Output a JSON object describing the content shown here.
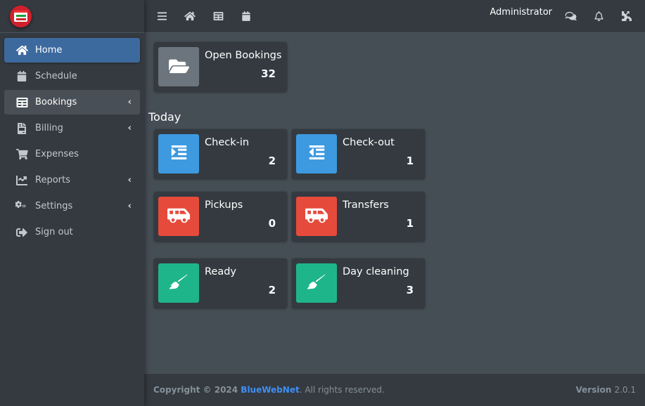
{
  "app": {
    "logo_icon": "calendar-logo-icon"
  },
  "sidebar": {
    "items": [
      {
        "label": "Home",
        "icon": "home-icon",
        "active": true,
        "has_submenu": false
      },
      {
        "label": "Schedule",
        "icon": "calendar-icon",
        "active": false,
        "has_submenu": false
      },
      {
        "label": "Bookings",
        "icon": "table-list-icon",
        "active": false,
        "has_submenu": true,
        "highlighted": true
      },
      {
        "label": "Billing",
        "icon": "invoice-icon",
        "active": false,
        "has_submenu": true
      },
      {
        "label": "Expenses",
        "icon": "cart-plus-icon",
        "active": false,
        "has_submenu": false
      },
      {
        "label": "Reports",
        "icon": "chart-line-icon",
        "active": false,
        "has_submenu": true
      },
      {
        "label": "Settings",
        "icon": "cogs-icon",
        "active": false,
        "has_submenu": true
      },
      {
        "label": "Sign out",
        "icon": "sign-out-icon",
        "active": false,
        "has_submenu": false
      }
    ],
    "chevron": "‹"
  },
  "topbar": {
    "left_icons": [
      "menu-icon",
      "home-icon",
      "table-list-icon",
      "calendar-icon"
    ],
    "user": "Administrator",
    "right_icons": [
      "chat-icon",
      "bell-icon",
      "expand-icon"
    ]
  },
  "dashboard": {
    "open_bookings": {
      "title": "Open Bookings",
      "value": "32",
      "icon": "folder-open-icon",
      "color": "#6c757d"
    },
    "section_title": "Today",
    "cards": [
      {
        "title": "Check-in",
        "value": "2",
        "icon": "indent-icon",
        "color": "#3d9ae0"
      },
      {
        "title": "Check-out",
        "value": "1",
        "icon": "outdent-icon",
        "color": "#3d9ae0"
      },
      {
        "title": "Pickups",
        "value": "0",
        "icon": "shuttle-van-icon",
        "color": "#e64a3b"
      },
      {
        "title": "Transfers",
        "value": "1",
        "icon": "shuttle-van-icon",
        "color": "#e64a3b"
      },
      {
        "title": "Ready",
        "value": "2",
        "icon": "broom-icon",
        "color": "#1fb58a"
      },
      {
        "title": "Day cleaning",
        "value": "3",
        "icon": "broom-icon",
        "color": "#1fb58a"
      }
    ]
  },
  "footer": {
    "copyright_prefix": "Copyright © 2024",
    "brand": "BlueWebNet",
    "rights": ". All rights reserved.",
    "version_label": "Version",
    "version": "2.0.1"
  }
}
